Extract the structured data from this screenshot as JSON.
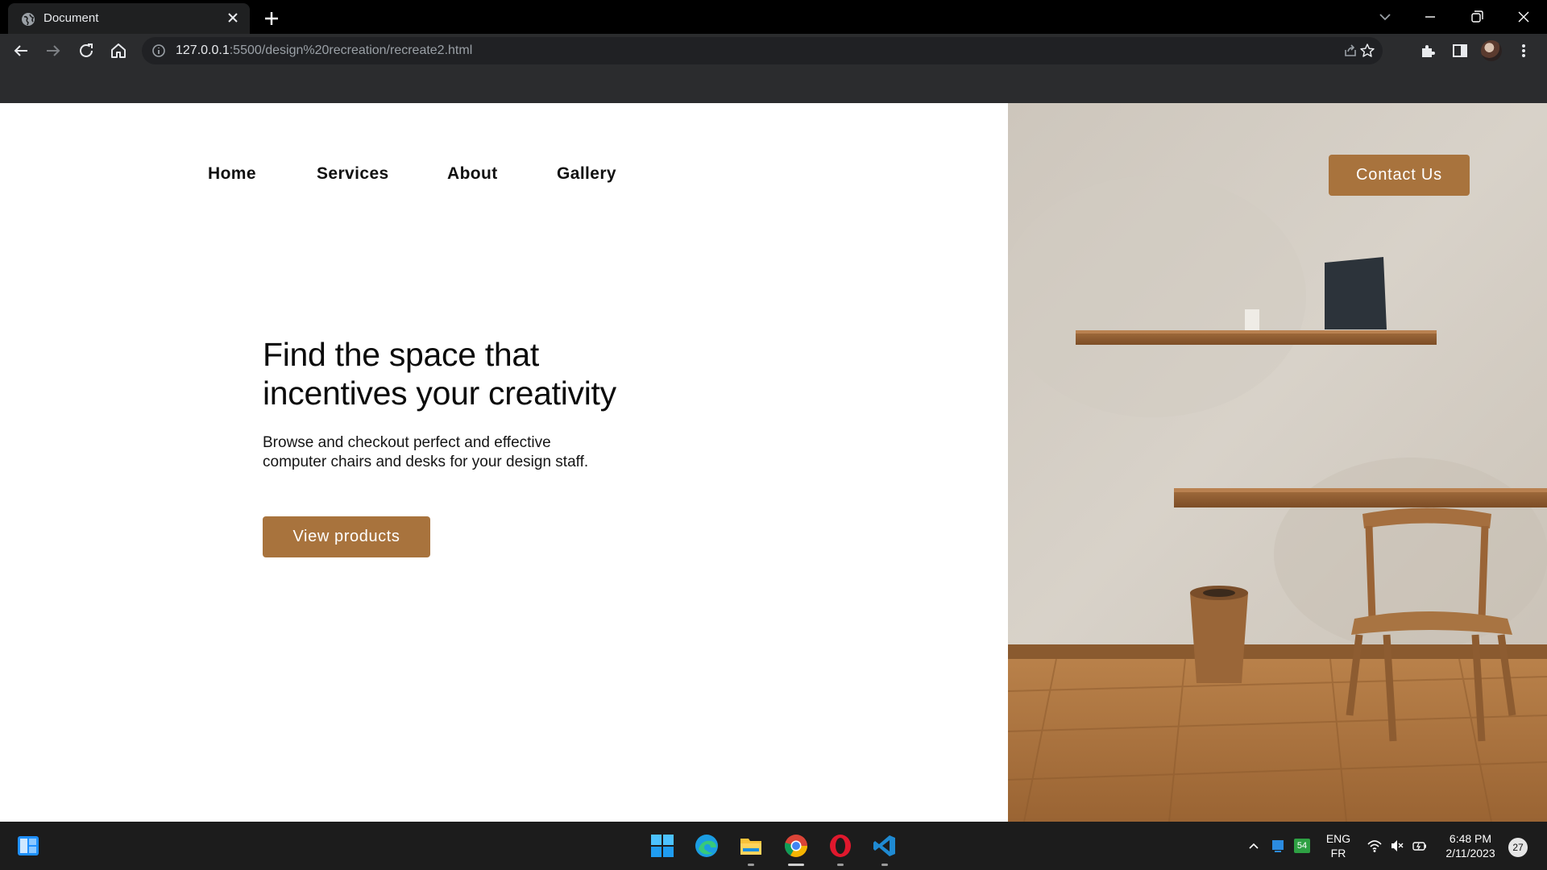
{
  "browser": {
    "tab_title": "Document",
    "url_host": "127.0.0.1",
    "url_rest": ":5500/design%20recreation/recreate2.html"
  },
  "page": {
    "nav": [
      "Home",
      "Services",
      "About",
      "Gallery"
    ],
    "contact_button": "Contact Us",
    "hero_title_line1": "Find the space that",
    "hero_title_line2": "incentives your creativity",
    "hero_description": "Browse and checkout perfect and effective computer chairs and desks for your design staff.",
    "cta_button": "View products",
    "accent_color": "#a8733d"
  },
  "taskbar": {
    "apps": [
      "start-icon",
      "edge-icon",
      "file-explorer-icon",
      "chrome-icon",
      "opera-icon",
      "vscode-icon"
    ],
    "tray_badge": "54",
    "language_top": "ENG",
    "language_bottom": "FR",
    "time": "6:48 PM",
    "date": "2/11/2023",
    "notifications": "27"
  }
}
